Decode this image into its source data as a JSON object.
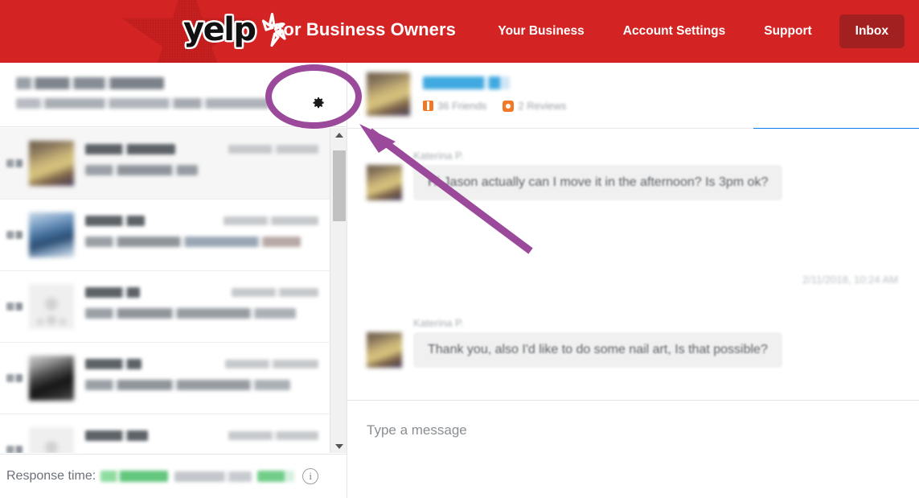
{
  "header": {
    "logo_text": "yelp",
    "logo_icon": "yelp-burst-icon",
    "title": "for Business Owners",
    "nav": [
      {
        "label": "Your Business",
        "name": "your-business"
      },
      {
        "label": "Account Settings",
        "name": "account-settings"
      },
      {
        "label": "Support",
        "name": "support"
      },
      {
        "label": "Inbox",
        "name": "inbox",
        "active": true
      }
    ],
    "background_color": "#d32323",
    "inbox_button_color": "#a32020"
  },
  "business_bar": {
    "business_name": "The Classic Nail Shop",
    "business_address": "4000 Piedmont Ave Oakland, CA 94611",
    "name_redacted": true,
    "address_redacted": true,
    "settings_icon": "gear-icon"
  },
  "conversation_list": {
    "rows": [
      {
        "name": "Katerina P.",
        "timestamp": "2/11/2018, 10:44 AM",
        "snippet": "You: Sounds good",
        "avatar": "av-kat",
        "active": true,
        "redacted": true
      },
      {
        "name": "Robyn G.",
        "timestamp": "2/10/2018, 9:15 AM",
        "snippet": "Robyn G.: Great thanks! See you!...",
        "avatar": "av-blue",
        "active": false,
        "redacted": true
      },
      {
        "name": "Karla G.",
        "timestamp": "2/9/2018, 6:20 PM",
        "snippet": "You: Hi Karla, Just wanted to say...",
        "avatar": "av-gray",
        "active": false,
        "redacted": true
      },
      {
        "name": "Leslie B.",
        "timestamp": "2/8/2018, 5:25 PM",
        "snippet": "You: Hey Leslie, just wanted to pi...",
        "avatar": "av-dark",
        "active": false,
        "redacted": true
      },
      {
        "name": "Leslie L.",
        "timestamp": "2/8/2018, 9:41 AM",
        "snippet": "",
        "avatar": "av-gray",
        "active": false,
        "redacted": true
      }
    ],
    "scrollbar": {
      "up_icon": "chevron-up-icon",
      "down_icon": "chevron-down-icon",
      "thumb_name": "scroll-thumb"
    }
  },
  "response_footer": {
    "label": "Response time:",
    "value": "34 minutes",
    "rate_label": "Response rate:",
    "rate_value": "100%",
    "values_redacted": true,
    "info_icon": "info-icon",
    "info_glyph": "i"
  },
  "conversation": {
    "contact_name": "Katerina P.",
    "contact_name_redacted": true,
    "friends_count": "36 Friends",
    "reviews_count": "2 Reviews",
    "friends_icon": "friends-icon",
    "reviews_icon": "reviews-icon",
    "accent_bar_color": "#0a7ff0",
    "messages": [
      {
        "author": "Katerina P.",
        "text": "Hi Jason actually can I move it in the afternoon? Is 3pm ok?",
        "timestamp": ""
      },
      {
        "author": "Katerina P.",
        "text": "Thank you, also I'd like to do some nail art, Is that possible?",
        "timestamp": "2/11/2018, 10:24 AM"
      }
    ],
    "composer_placeholder": "Type a message",
    "composer_value": ""
  },
  "annotation": {
    "color": "#9b4a9b",
    "ellipse_label": "highlight-ellipse-around-gear",
    "arrow_label": "pointer-arrow-to-gear"
  }
}
